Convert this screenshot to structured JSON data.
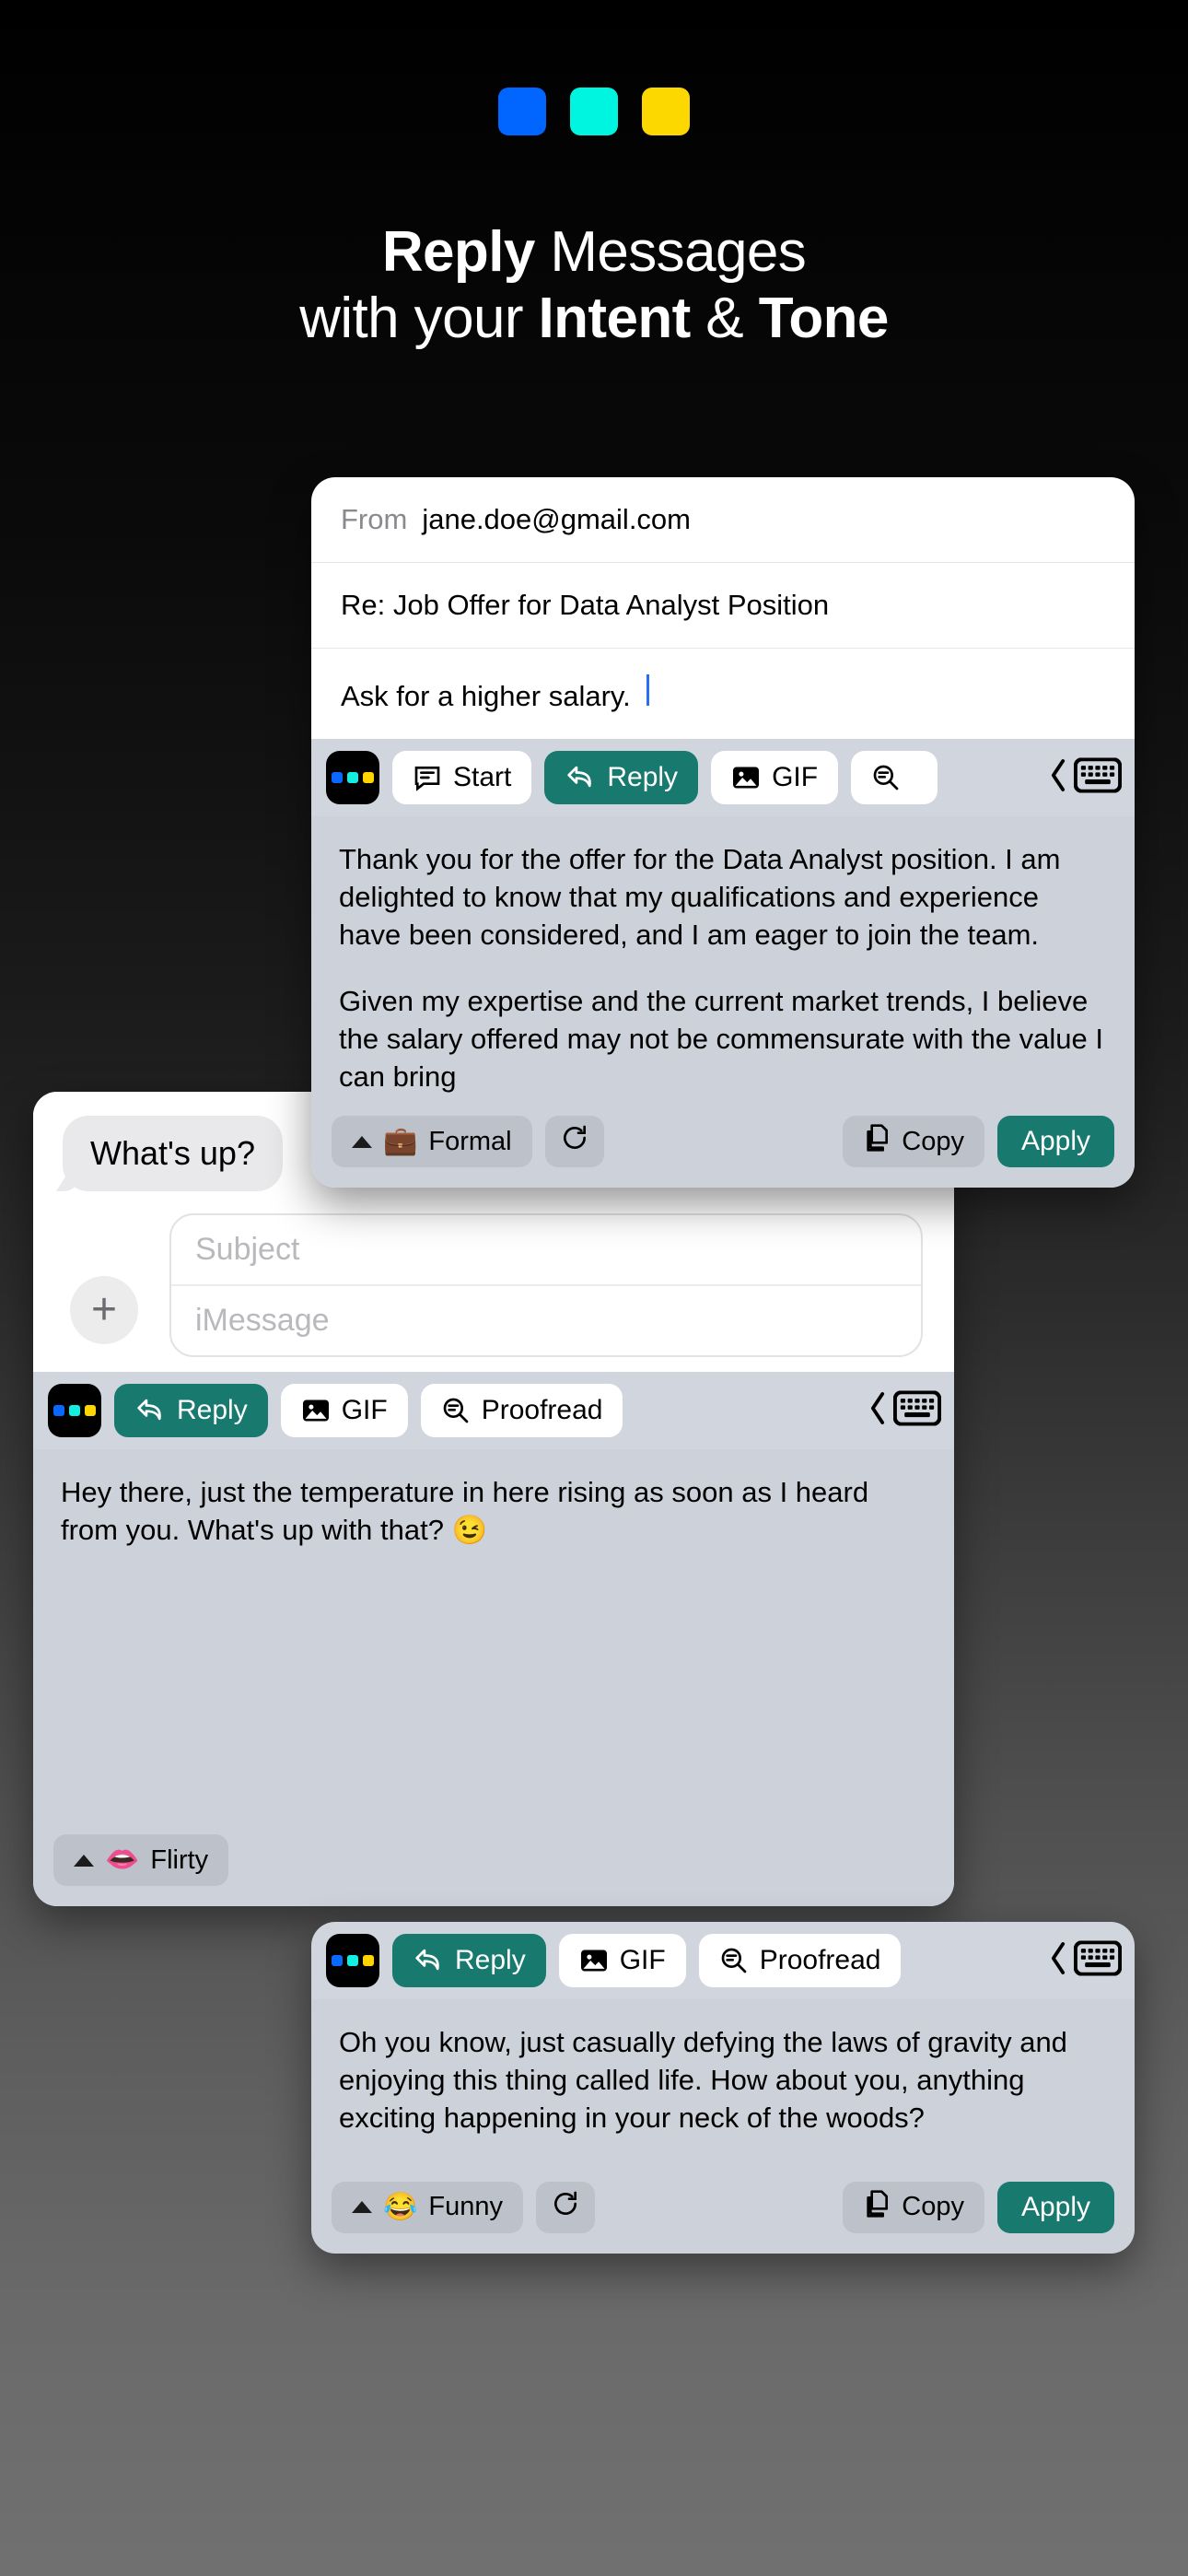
{
  "brand": {
    "logo_colors": [
      "#0066ff",
      "#00f5e0",
      "#fdd800"
    ],
    "accent_teal": "#18796f",
    "caret_blue": "#2a6ef5"
  },
  "headline": {
    "line1_bold": "Reply",
    "line1_rest": " Messages",
    "line2_a": "with your ",
    "line2_bold1": "Intent",
    "line2_amp": " & ",
    "line2_bold2": "Tone"
  },
  "email_card": {
    "from_label": "From",
    "from_value": "jane.doe@gmail.com",
    "subject": "Re: Job Offer for Data Analyst Position",
    "prompt": "Ask for a higher salary.",
    "toolbar": {
      "start_label": "Start",
      "reply_label": "Reply",
      "gif_label": "GIF",
      "keyboard_icon": "keyboard-icon",
      "collapse_icon": "chevron-left-icon"
    },
    "suggestion_p1": "Thank you for the offer for the Data Analyst position. I am delighted to know that my qualifications and experience have been considered, and I am eager to join the team.",
    "suggestion_p2": "Given my expertise and the current market trends, I believe the salary offered may not be commensurate with the value I can bring",
    "actions": {
      "tone_emoji": "💼",
      "tone_label": "Formal",
      "regenerate_icon": "refresh-icon",
      "copy_label": "Copy",
      "apply_label": "Apply"
    }
  },
  "imessage_card": {
    "bubble_text": "What's up?",
    "subject_placeholder": "Subject",
    "message_placeholder": "iMessage",
    "add_button": "+",
    "toolbar": {
      "reply_label": "Reply",
      "gif_label": "GIF",
      "proofread_label": "Proofread",
      "keyboard_icon": "keyboard-icon",
      "collapse_icon": "chevron-left-icon"
    },
    "suggestion": "Hey there, just the temperature in here rising as soon as I heard from you. What's up with that? 😉",
    "actions": {
      "tone_emoji": "👄",
      "tone_label": "Flirty"
    }
  },
  "funny_card": {
    "toolbar": {
      "reply_label": "Reply",
      "gif_label": "GIF",
      "proofread_label": "Proofread",
      "keyboard_icon": "keyboard-icon",
      "collapse_icon": "chevron-left-icon"
    },
    "suggestion": "Oh you know, just casually defying the laws of gravity and enjoying this thing called life. How about you, anything exciting happening in your neck of the woods?",
    "actions": {
      "tone_emoji": "😂",
      "tone_label": "Funny",
      "regenerate_icon": "refresh-icon",
      "copy_label": "Copy",
      "apply_label": "Apply"
    }
  }
}
